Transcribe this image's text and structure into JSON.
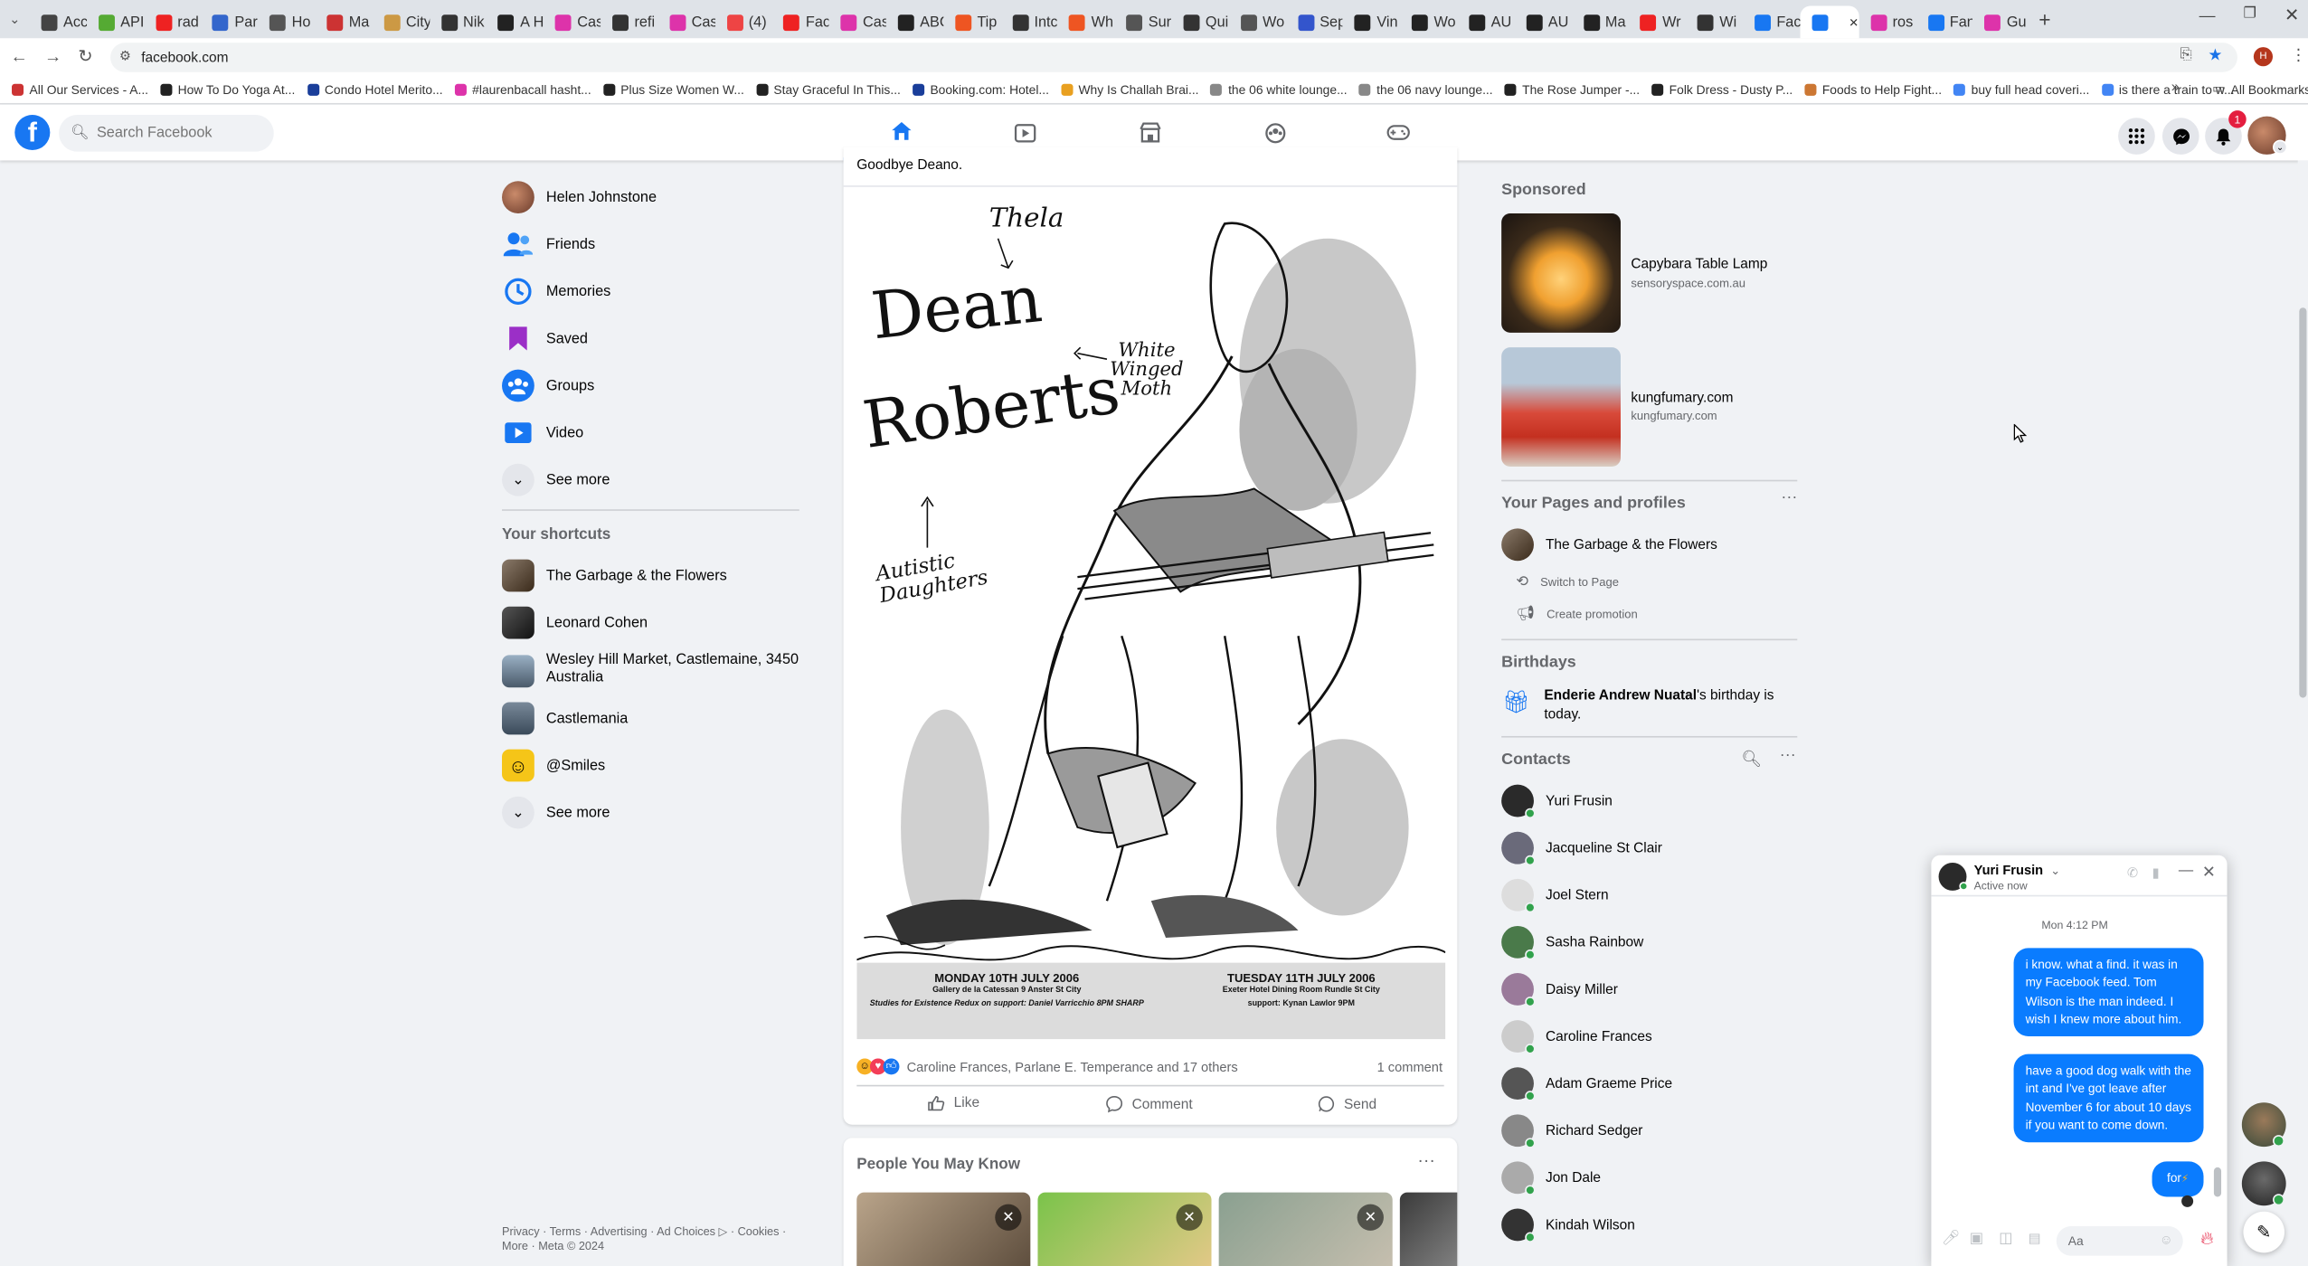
{
  "browser": {
    "tabs": [
      {
        "label": "Acc",
        "color": "#444"
      },
      {
        "label": "API",
        "color": "#5a3"
      },
      {
        "label": "rad",
        "color": "#e22"
      },
      {
        "label": "Par",
        "color": "#36c"
      },
      {
        "label": "Ho",
        "color": "#555"
      },
      {
        "label": "Ma",
        "color": "#c33"
      },
      {
        "label": "City",
        "color": "#c94"
      },
      {
        "label": "Nik",
        "color": "#333"
      },
      {
        "label": "A H",
        "color": "#222"
      },
      {
        "label": "Cas",
        "color": "#d3a"
      },
      {
        "label": "refi",
        "color": "#333"
      },
      {
        "label": "Cas",
        "color": "#d3a"
      },
      {
        "label": "(4)",
        "color": "#e44"
      },
      {
        "label": "Fac",
        "color": "#e22"
      },
      {
        "label": "Cas",
        "color": "#d3a"
      },
      {
        "label": "ABC",
        "color": "#222"
      },
      {
        "label": "Tip",
        "color": "#e52"
      },
      {
        "label": "Intc",
        "color": "#333"
      },
      {
        "label": "Wh",
        "color": "#e52"
      },
      {
        "label": "Sur",
        "color": "#555"
      },
      {
        "label": "Qui",
        "color": "#333"
      },
      {
        "label": "Wo",
        "color": "#555"
      },
      {
        "label": "Sep",
        "color": "#35c"
      },
      {
        "label": "Vin",
        "color": "#222"
      },
      {
        "label": "Wo",
        "color": "#222"
      },
      {
        "label": "AU",
        "color": "#222"
      },
      {
        "label": "AU",
        "color": "#222"
      },
      {
        "label": "Ma",
        "color": "#222"
      },
      {
        "label": "Wr",
        "color": "#e22"
      },
      {
        "label": "Wi",
        "color": "#333"
      },
      {
        "label": "Fac",
        "color": "#1877f2"
      },
      {
        "label": "",
        "color": "#1877f2"
      },
      {
        "label": "ros",
        "color": "#d3a"
      },
      {
        "label": "Fan",
        "color": "#1877f2"
      },
      {
        "label": "Gu",
        "color": "#d3a"
      }
    ],
    "url": "facebook.com",
    "bookmarks": [
      {
        "label": "All Our Services - A...",
        "color": "#c33"
      },
      {
        "label": "How To Do Yoga At...",
        "color": "#222"
      },
      {
        "label": "Condo Hotel Merito...",
        "color": "#1a3e9a"
      },
      {
        "label": "#laurenbacall hasht...",
        "color": "#d3a"
      },
      {
        "label": "Plus Size Women W...",
        "color": "#222"
      },
      {
        "label": "Stay Graceful In This...",
        "color": "#222"
      },
      {
        "label": "Booking.com: Hotel...",
        "color": "#1a3e9a"
      },
      {
        "label": "Why Is Challah Brai...",
        "color": "#e9a020"
      },
      {
        "label": "the 06 white lounge...",
        "color": "#888"
      },
      {
        "label": "the 06 navy lounge...",
        "color": "#888"
      },
      {
        "label": "The Rose Jumper -...",
        "color": "#222"
      },
      {
        "label": "Folk Dress - Dusty P...",
        "color": "#222"
      },
      {
        "label": "Foods to Help Fight...",
        "color": "#c73"
      },
      {
        "label": "buy full head coveri...",
        "color": "#4285f4"
      },
      {
        "label": "is there a train to w...",
        "color": "#4285f4"
      }
    ],
    "all_bookmarks": "All Bookmarks",
    "profile_initial": "H"
  },
  "header": {
    "search_placeholder": "Search Facebook",
    "notification_count": "1"
  },
  "left": {
    "items": [
      {
        "label": "Helen Johnstone",
        "color": "#a87a60"
      },
      {
        "label": "Friends",
        "color": "#1877f2"
      },
      {
        "label": "Memories",
        "color": "#1877f2"
      },
      {
        "label": "Saved",
        "color": "#9b2fc7"
      },
      {
        "label": "Groups",
        "color": "#1877f2"
      },
      {
        "label": "Video",
        "color": "#1877f2"
      },
      {
        "label": "See more",
        "color": "#e4e6eb"
      }
    ],
    "shortcuts_title": "Your shortcuts",
    "shortcuts": [
      {
        "label": "The Garbage & the Flowers",
        "label2": "",
        "color": "#6b5a48"
      },
      {
        "label": "Leonard Cohen",
        "label2": "",
        "color": "#333"
      },
      {
        "label": "Wesley Hill Market, Castlemaine, 3450",
        "label2": "Australia",
        "color": "#7a8a9a"
      },
      {
        "label": "Castlemania",
        "label2": "",
        "color": "#5a6a7a"
      },
      {
        "label": "@Smiles",
        "label2": "",
        "color": "#f5c518"
      },
      {
        "label": "See more",
        "label2": "",
        "color": "#e4e6eb"
      }
    ],
    "footer1": "Privacy · Terms · Advertising · Ad Choices ▷ · Cookies ·",
    "footer2": "More · Meta © 2024"
  },
  "post": {
    "caption": "Goodbye Deano.",
    "poster": {
      "label_thela": "Thela",
      "title1": "Dean",
      "title2": "Roberts",
      "label_moth1": "White",
      "label_moth2": "Winged",
      "label_moth3": "Moth",
      "label_daughters1": "Autistic",
      "label_daughters2": "Daughters",
      "left_date": "MONDAY 10TH JULY 2006",
      "left_venue": "Gallery de la Catessan 9 Anster St City",
      "left_support": "Studies for Existence Redux on support: Daniel Varricchio 8PM SHARP",
      "right_date": "TUESDAY 11TH JULY 2006",
      "right_venue": "Exeter Hotel Dining Room Rundle St City",
      "right_support": "support: Kynan Lawlor 9PM"
    },
    "reactions_text": "Caroline Frances, Parlane E. Temperance and 17 others",
    "comments": "1 comment",
    "like": "Like",
    "comment": "Comment",
    "send": "Send"
  },
  "pymk": {
    "title": "People You May Know"
  },
  "right": {
    "sponsored_title": "Sponsored",
    "ads": [
      {
        "title": "Capybara Table Lamp",
        "domain": "sensoryspace.com.au"
      },
      {
        "title": "kungfumary.com",
        "domain": "kungfumary.com"
      }
    ],
    "pages_title": "Your Pages and profiles",
    "page_name": "The Garbage & the Flowers",
    "switch_page": "Switch to Page",
    "create_promo": "Create promotion",
    "birthdays_title": "Birthdays",
    "birthday_name": "Enderie Andrew Nuatal",
    "birthday_rest": "'s birthday is",
    "birthday_rest2": "today.",
    "contacts_title": "Contacts",
    "contacts": [
      {
        "name": "Yuri Frusin",
        "color": "#2a2a2a",
        "online": true
      },
      {
        "name": "Jacqueline St Clair",
        "color": "#6a6a7a",
        "online": true
      },
      {
        "name": "Joel Stern",
        "color": "#ddd",
        "online": true
      },
      {
        "name": "Sasha Rainbow",
        "color": "#4a7a4a",
        "online": true
      },
      {
        "name": "Daisy Miller",
        "color": "#9a7a9a",
        "online": true
      },
      {
        "name": "Caroline Frances",
        "color": "#ccc",
        "online": true
      },
      {
        "name": "Adam Graeme Price",
        "color": "#555",
        "online": true
      },
      {
        "name": "Richard Sedger",
        "color": "#888",
        "online": true
      },
      {
        "name": "Jon Dale",
        "color": "#aaa",
        "online": true
      },
      {
        "name": "Kindah Wilson",
        "color": "#333",
        "online": true
      }
    ]
  },
  "chat": {
    "name": "Yuri Frusin",
    "status": "Active now",
    "time": "Mon 4:12 PM",
    "messages": [
      "i know. what a find. it was in my Facebook feed. Tom Wilson is the man indeed. I wish I knew more about him.",
      "have a good dog walk with the int and I've got leave after November 6 for about 10 days if you want to come down.",
      "for"
    ],
    "input_placeholder": "Aa"
  },
  "colors": {
    "fb_blue": "#1877f2",
    "messenger_blue": "#0a7cff",
    "online_green": "#31a24c",
    "text_secondary": "#65676b",
    "page_bg": "#f0f2f5"
  }
}
